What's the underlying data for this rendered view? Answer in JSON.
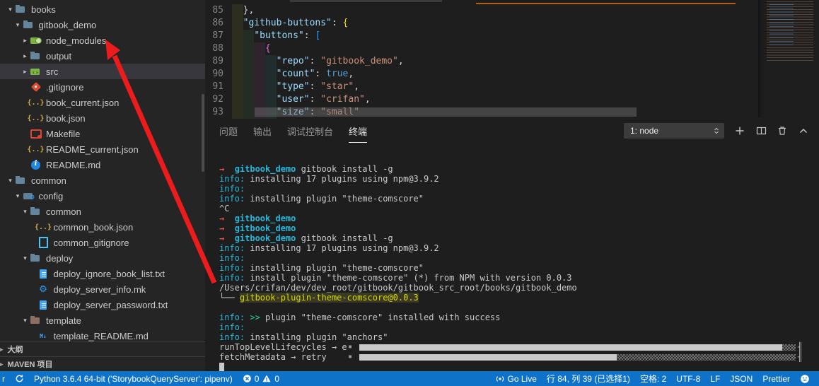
{
  "explorer": {
    "tree": [
      {
        "label": "books",
        "depth": 0,
        "arrow": "exp",
        "icon": "folder-icon"
      },
      {
        "label": "gitbook_demo",
        "depth": 1,
        "arrow": "exp",
        "icon": "folder-icon"
      },
      {
        "label": "node_modules",
        "depth": 2,
        "arrow": "col",
        "icon": "npm-folder-icon"
      },
      {
        "label": "output",
        "depth": 2,
        "arrow": "col",
        "icon": "folder-icon"
      },
      {
        "label": "src",
        "depth": 2,
        "arrow": "col",
        "icon": "src-folder-icon",
        "selected": true
      },
      {
        "label": ".gitignore",
        "depth": 2,
        "icon": "git-icon"
      },
      {
        "label": "book_current.json",
        "depth": 2,
        "icon": "json-icon"
      },
      {
        "label": "book.json",
        "depth": 2,
        "icon": "json-icon"
      },
      {
        "label": "Makefile",
        "depth": 2,
        "icon": "makefile-icon"
      },
      {
        "label": "README_current.json",
        "depth": 2,
        "icon": "json-icon"
      },
      {
        "label": "README.md",
        "depth": 2,
        "icon": "info-icon"
      },
      {
        "label": "common",
        "depth": 0,
        "arrow": "exp",
        "icon": "folder-icon"
      },
      {
        "label": "config",
        "depth": 1,
        "arrow": "exp",
        "icon": "config-folder-icon"
      },
      {
        "label": "common",
        "depth": 2,
        "arrow": "exp",
        "icon": "folder-icon"
      },
      {
        "label": "common_book.json",
        "depth": 3,
        "icon": "json-icon"
      },
      {
        "label": "common_gitignore",
        "depth": 3,
        "icon": "file-icon"
      },
      {
        "label": "deploy",
        "depth": 2,
        "arrow": "exp",
        "icon": "folder-icon"
      },
      {
        "label": "deploy_ignore_book_list.txt",
        "depth": 3,
        "icon": "doc-icon"
      },
      {
        "label": "deploy_server_info.mk",
        "depth": 3,
        "icon": "gear-icon"
      },
      {
        "label": "deploy_server_password.txt",
        "depth": 3,
        "icon": "doc-icon"
      },
      {
        "label": "template",
        "depth": 2,
        "arrow": "exp",
        "icon": "template-folder-icon"
      },
      {
        "label": "template_README.md",
        "depth": 3,
        "icon": "markdown-icon"
      }
    ],
    "sections": [
      {
        "label": "大纲"
      },
      {
        "label": "MAVEN 项目"
      }
    ]
  },
  "editor": {
    "lines": [
      {
        "num": "85",
        "indent": 2,
        "tokens": [
          {
            "t": "},",
            "c": "punct"
          }
        ]
      },
      {
        "num": "86",
        "indent": 2,
        "tokens": [
          {
            "t": "\"github-buttons\"",
            "c": "key"
          },
          {
            "t": ": ",
            "c": "punct"
          },
          {
            "t": "{",
            "c": "b1"
          }
        ]
      },
      {
        "num": "87",
        "indent": 4,
        "tokens": [
          {
            "t": "\"buttons\"",
            "c": "key"
          },
          {
            "t": ": ",
            "c": "punct"
          },
          {
            "t": "[",
            "c": "b2"
          }
        ]
      },
      {
        "num": "88",
        "indent": 6,
        "tokens": [
          {
            "t": "{",
            "c": "b3"
          }
        ]
      },
      {
        "num": "89",
        "indent": 8,
        "tokens": [
          {
            "t": "\"repo\"",
            "c": "key"
          },
          {
            "t": ": ",
            "c": "punct"
          },
          {
            "t": "\"gitbook_demo\"",
            "c": "str"
          },
          {
            "t": ",",
            "c": "punct"
          }
        ]
      },
      {
        "num": "90",
        "indent": 8,
        "tokens": [
          {
            "t": "\"count\"",
            "c": "key"
          },
          {
            "t": ": ",
            "c": "punct"
          },
          {
            "t": "true",
            "c": "bool"
          },
          {
            "t": ",",
            "c": "punct"
          }
        ]
      },
      {
        "num": "91",
        "indent": 8,
        "tokens": [
          {
            "t": "\"type\"",
            "c": "key"
          },
          {
            "t": ": ",
            "c": "punct"
          },
          {
            "t": "\"star\"",
            "c": "str"
          },
          {
            "t": ",",
            "c": "punct"
          }
        ]
      },
      {
        "num": "92",
        "indent": 8,
        "tokens": [
          {
            "t": "\"user\"",
            "c": "key"
          },
          {
            "t": ": ",
            "c": "punct"
          },
          {
            "t": "\"crifan\"",
            "c": "str"
          },
          {
            "t": ",",
            "c": "punct"
          }
        ]
      },
      {
        "num": "93",
        "indent": 8,
        "tokens": [
          {
            "t": "\"size\"",
            "c": "key"
          },
          {
            "t": ": ",
            "c": "punct"
          },
          {
            "t": "\"small\"",
            "c": "str"
          }
        ]
      }
    ]
  },
  "panel": {
    "tabs": [
      {
        "label": "问题"
      },
      {
        "label": "输出"
      },
      {
        "label": "调试控制台"
      },
      {
        "label": "终端",
        "active": true
      }
    ],
    "dropdown": "1: node"
  },
  "terminal": {
    "lines": [
      {
        "segs": [
          {
            "t": "→  ",
            "c": "prompt"
          },
          {
            "t": "gitbook_demo",
            "c": "name"
          },
          {
            "t": " gitbook install -g",
            "c": "text"
          }
        ]
      },
      {
        "segs": [
          {
            "t": "info:",
            "c": "info"
          },
          {
            "t": " installing 17 plugins using npm@3.9.2",
            "c": "text"
          }
        ]
      },
      {
        "segs": [
          {
            "t": "info:",
            "c": "info"
          }
        ]
      },
      {
        "segs": [
          {
            "t": "info:",
            "c": "info"
          },
          {
            "t": " installing plugin \"theme-comscore\"",
            "c": "text"
          }
        ]
      },
      {
        "segs": [
          {
            "t": "^C",
            "c": "text"
          }
        ]
      },
      {
        "segs": [
          {
            "t": "→  ",
            "c": "prompt"
          },
          {
            "t": "gitbook_demo",
            "c": "name"
          }
        ]
      },
      {
        "segs": [
          {
            "t": "→  ",
            "c": "prompt"
          },
          {
            "t": "gitbook_demo",
            "c": "name"
          }
        ]
      },
      {
        "segs": [
          {
            "t": "→  ",
            "c": "prompt"
          },
          {
            "t": "gitbook_demo",
            "c": "name"
          },
          {
            "t": " gitbook install -g",
            "c": "text"
          }
        ]
      },
      {
        "segs": [
          {
            "t": "info:",
            "c": "info"
          },
          {
            "t": " installing 17 plugins using npm@3.9.2",
            "c": "text"
          }
        ]
      },
      {
        "segs": [
          {
            "t": "info:",
            "c": "info"
          }
        ]
      },
      {
        "segs": [
          {
            "t": "info:",
            "c": "info"
          },
          {
            "t": " installing plugin \"theme-comscore\"",
            "c": "text"
          }
        ]
      },
      {
        "segs": [
          {
            "t": "info:",
            "c": "info"
          },
          {
            "t": " install plugin \"theme-comscore\" (*) from NPM with version 0.0.3",
            "c": "text"
          }
        ]
      },
      {
        "segs": [
          {
            "t": "/Users/crifan/dev/dev_root/gitbook/gitbook_src_root/books/gitbook_demo",
            "c": "text"
          }
        ]
      },
      {
        "segs": [
          {
            "t": "└── ",
            "c": "text"
          },
          {
            "t": "gitbook-plugin-theme-comscore@0.0.3",
            "c": "match"
          }
        ]
      },
      {
        "segs": []
      },
      {
        "segs": [
          {
            "t": "info:",
            "c": "info"
          },
          {
            "t": " ",
            "c": "text"
          },
          {
            "t": ">>",
            "c": "green"
          },
          {
            "t": " plugin \"theme-comscore\" installed with success",
            "c": "text"
          }
        ]
      },
      {
        "segs": [
          {
            "t": "info:",
            "c": "info"
          }
        ]
      },
      {
        "segs": [
          {
            "t": "info:",
            "c": "info"
          },
          {
            "t": " installing plugin \"anchors\"",
            "c": "text"
          }
        ]
      },
      {
        "type": "bar",
        "label": "runTopLevelLifecycles → e",
        "solid": 0.97
      },
      {
        "type": "bar",
        "label": "fetchMetadata → retry",
        "solid": 0.59
      },
      {
        "type": "cursor"
      }
    ]
  },
  "statusbar": {
    "branch_fragment": "r",
    "python": "Python 3.6.4 64-bit ('StorybookQueryServer': pipenv)",
    "errors": "0",
    "warnings": "0",
    "go_live": "Go Live",
    "line_col": "行 84, 列 39 (已选择1)",
    "spaces": "空格: 2",
    "encoding": "UTF-8",
    "eol": "LF",
    "language": "JSON",
    "formatter": "Prettier"
  },
  "colors": {
    "statusbar_blue": "#0E72C8",
    "annotation_arrow": "#EC1C1C",
    "sidebar_bg": "#252526",
    "editor_bg": "#1e1e1e"
  }
}
